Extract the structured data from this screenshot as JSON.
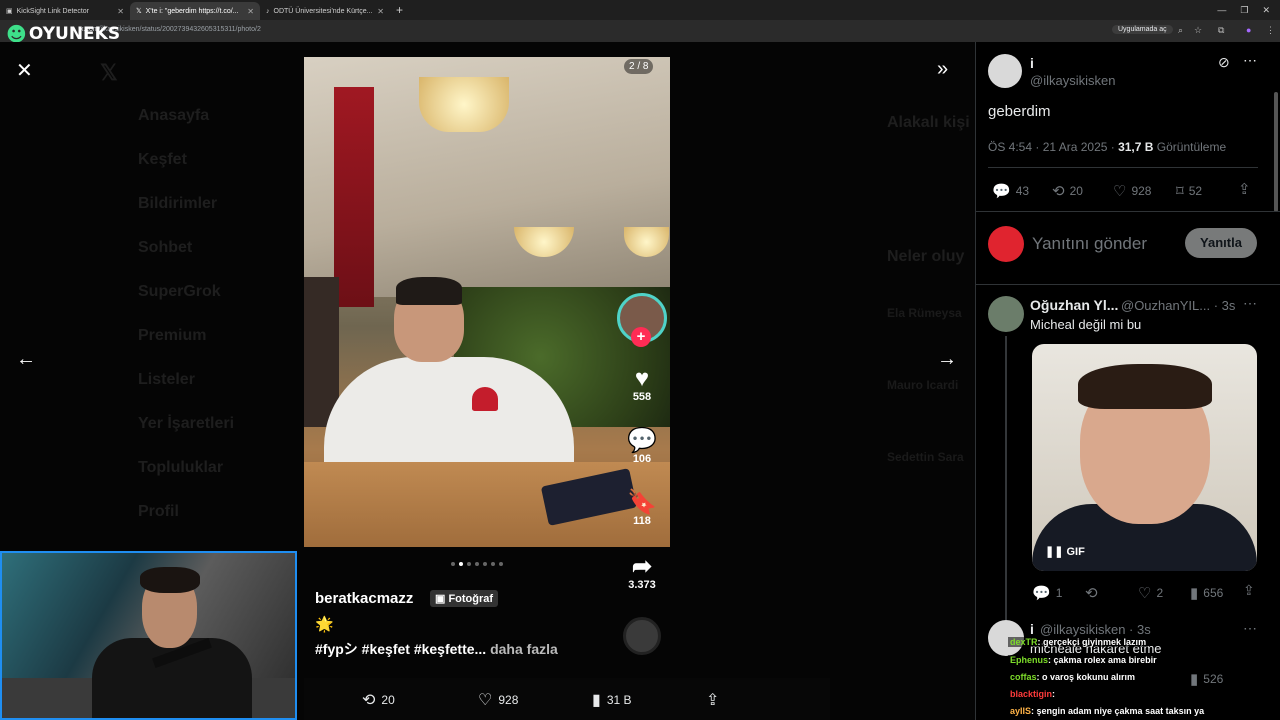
{
  "browser": {
    "tabs": [
      {
        "title": "KickSight Link Detector"
      },
      {
        "title": "X'te i: \"geberdim https://t.co/..."
      },
      {
        "title": "ODTÜ Üniversitesi'nde Kürtçe..."
      }
    ],
    "url_host": "x.com",
    "url_path": "/ilkaysikisken/status/2002739432605315311/photo/2",
    "app_chip": "Uygulamada aç"
  },
  "overlay_logo": "OYUNEKS",
  "background_nav": [
    "Anasayfa",
    "Keşfet",
    "Bildirimler",
    "Sohbet",
    "SuperGrok",
    "Premium",
    "Listeler",
    "Yer İşaretleri",
    "Topluluklar",
    "Profil"
  ],
  "background_right": {
    "related": "Alakalı kişi",
    "trends": "Neler oluy",
    "items": [
      "Ela Rümeysa",
      "Mauro Icardi",
      "Sedettin Sara"
    ]
  },
  "media": {
    "counter": "2 / 8",
    "likes": "558",
    "comments": "106",
    "saves": "118",
    "shares": "3.373",
    "username": "beratkacmazz",
    "badge": "Fotoğraf",
    "emoji": "🌟",
    "hashtags": "#fypシ #keşfet #keşfette...",
    "more": "daha fazla",
    "dots_total": 7,
    "dots_active": 2
  },
  "bottom_bar": {
    "retweets": "20",
    "likes": "928",
    "views": "31 B"
  },
  "tweet": {
    "author_name": "i",
    "author_handle": "@ilkaysikisken",
    "text": "geberdim",
    "time": "ÖS 4:54 · 21 Ara 2025 · ",
    "views_count": "31,7 B",
    "views_label": "Görüntüleme",
    "replies": "43",
    "retweets": "20",
    "likes": "928",
    "bookmarks": "52"
  },
  "compose": {
    "placeholder": "Yanıtını gönder",
    "button": "Yanıtla"
  },
  "reply1": {
    "name": "Oğuzhan Yl...",
    "handle": "@OuzhanYIL... · 3s",
    "text": "Micheal değil mi bu",
    "gif_label": "GIF",
    "replies": "1",
    "likes": "2",
    "views": "656"
  },
  "reply2": {
    "name": "i",
    "handle": "@ilkaysikisken · 3s",
    "text": "michealé hakaret etme",
    "views": "526"
  },
  "chat": [
    {
      "user": "dexTR",
      "msg": ": gerçekçi giyinmek lazım"
    },
    {
      "user": "Ephenus",
      "msg": ": çakma rolex ama birebir"
    },
    {
      "user": "coffas",
      "msg": ": o varoş kokunu alırım"
    },
    {
      "user": "blacktigin",
      "msg": ":"
    },
    {
      "user": "ayIIS",
      "msg": ": şengin adam niye çakma saat taksın ya"
    }
  ],
  "colors": {
    "accent": "#1d9bf0",
    "tiktok_red": "#ff2c55",
    "chat_user": "#7ddc2a"
  }
}
